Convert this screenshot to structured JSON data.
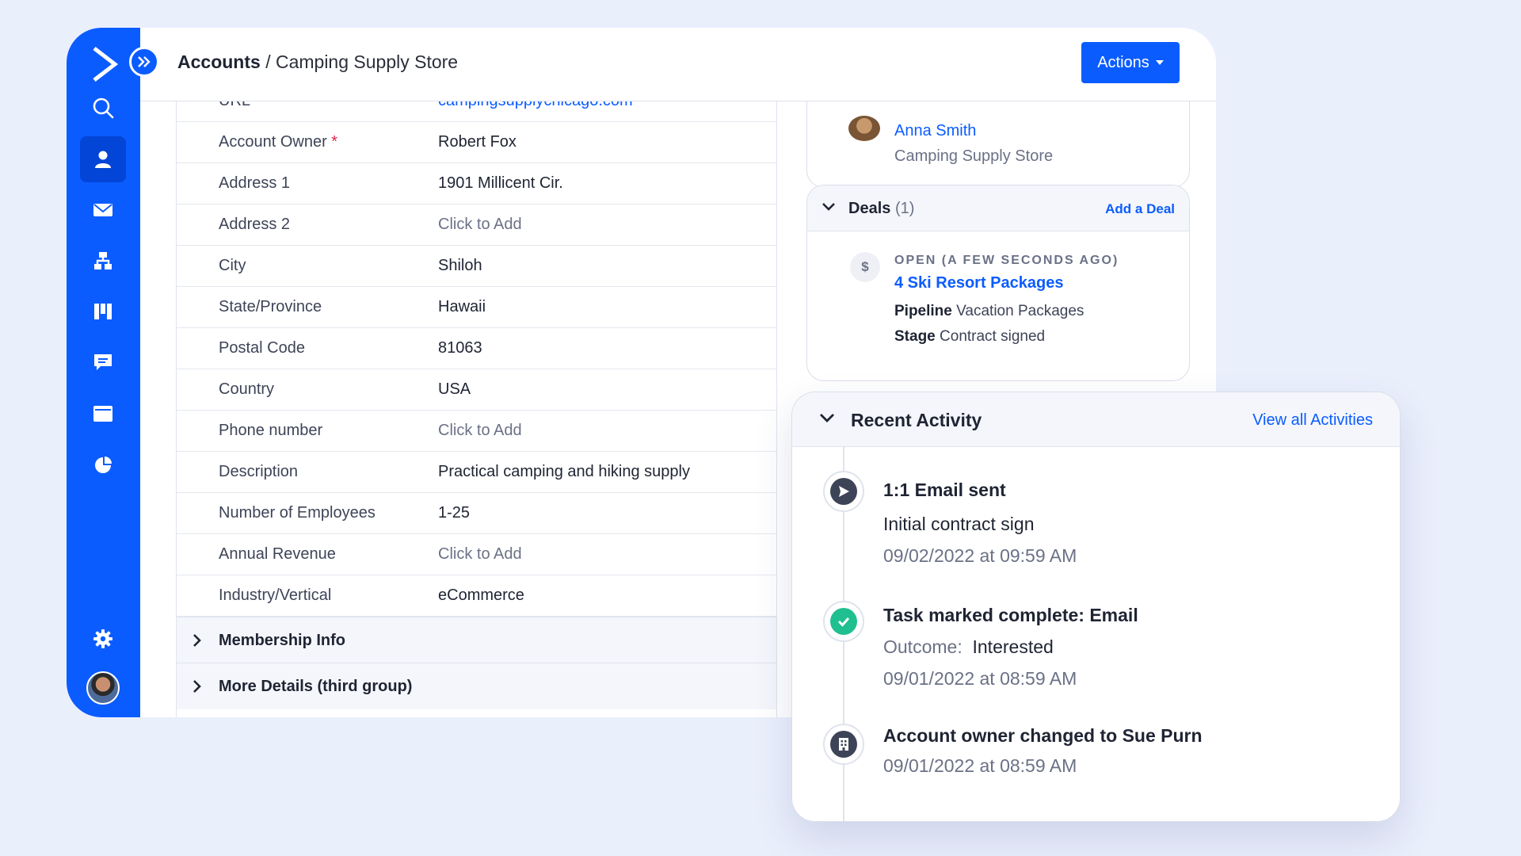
{
  "breadcrumb": {
    "parent": "Accounts",
    "separator": "/",
    "current": "Camping Supply Store"
  },
  "toolbar": {
    "actions_label": "Actions"
  },
  "details": {
    "partial_row": {
      "label": "URL",
      "value": "campingsupplychicago.com"
    },
    "rows": [
      {
        "label": "Account Owner",
        "required_mark": "*",
        "value": "Robert Fox"
      },
      {
        "label": "Address 1",
        "value": "1901 Millicent Cir."
      },
      {
        "label": "Address 2",
        "value": "Click to Add"
      },
      {
        "label": "City",
        "value": "Shiloh"
      },
      {
        "label": "State/Province",
        "value": "Hawaii"
      },
      {
        "label": "Postal Code",
        "value": "81063"
      },
      {
        "label": "Country",
        "value": "USA"
      },
      {
        "label": "Phone number",
        "value": "Click to Add"
      },
      {
        "label": "Description",
        "value": "Practical camping and hiking supply"
      },
      {
        "label": "Number of Employees",
        "value": "1-25"
      },
      {
        "label": "Annual Revenue",
        "value": "Click to Add"
      },
      {
        "label": "Industry/Vertical",
        "value": "eCommerce"
      }
    ],
    "sections": [
      "Membership Info",
      "More Details (third group)"
    ]
  },
  "contact": {
    "name": "Anna Smith",
    "company": "Camping Supply Store"
  },
  "deals": {
    "title": "Deals",
    "count": "(1)",
    "add_label": "Add a Deal",
    "currency_icon": "$",
    "status": "OPEN (A FEW SECONDS AGO)",
    "name": "4 Ski Resort Packages",
    "pipeline_label": "Pipeline",
    "pipeline_value": "Vacation Packages",
    "stage_label": "Stage",
    "stage_value": "Contract signed"
  },
  "activity": {
    "title": "Recent Activity",
    "view_all": "View all Activities",
    "items": [
      {
        "icon": "email-sent-icon",
        "title": "1:1 Email sent",
        "subtitle": "Initial contract sign",
        "time": "09/02/2022 at 09:59 AM"
      },
      {
        "icon": "check-circle-icon",
        "title": "Task marked complete: Email",
        "outcome_label": "Outcome:",
        "outcome_value": "Interested",
        "time": "09/01/2022 at 08:59 AM"
      },
      {
        "icon": "building-icon",
        "title": "Account owner changed to Sue Purn",
        "time": "09/01/2022 at 08:59 AM"
      }
    ]
  },
  "colors": {
    "brand": "#0b5cff",
    "success": "#1fbf8f",
    "background": "#eaeffc"
  }
}
